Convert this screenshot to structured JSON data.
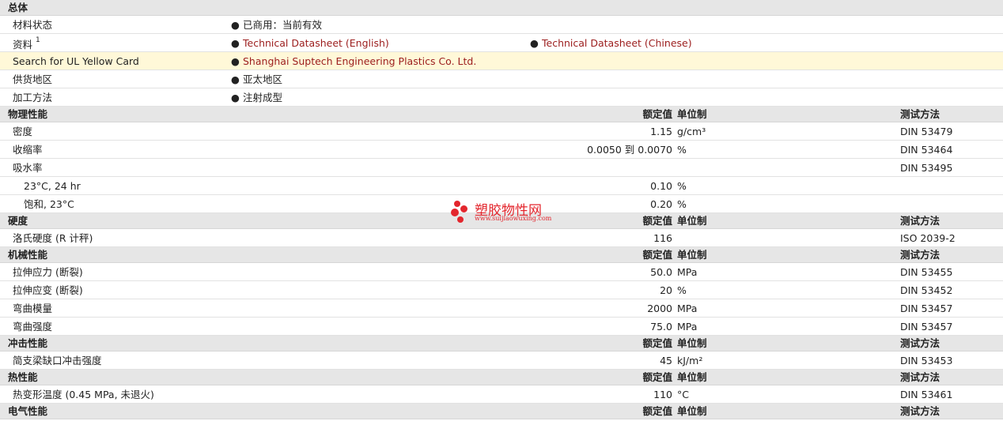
{
  "overview": {
    "title": "总体",
    "rows": [
      {
        "label": "材料状态",
        "items": [
          "已商用：当前有效"
        ]
      },
      {
        "label": "资料",
        "sup": "1",
        "items": [
          "Technical Datasheet (English)",
          "Technical Datasheet (Chinese)"
        ]
      },
      {
        "label": "Search for UL Yellow Card",
        "items": [
          "Shanghai Suptech Engineering Plastics Co. Ltd."
        ]
      },
      {
        "label": "供货地区",
        "items": [
          "亚太地区"
        ]
      },
      {
        "label": "加工方法",
        "items": [
          "注射成型"
        ]
      }
    ]
  },
  "columns": {
    "rated": "额定值",
    "unit": "单位制",
    "method": "测试方法"
  },
  "sections": [
    {
      "title": "物理性能",
      "rows": [
        {
          "label": "密度",
          "value": "1.15",
          "unit": "g/cm³",
          "method": "DIN 53479"
        },
        {
          "label": "收缩率",
          "value": "0.0050 到  0.0070",
          "unit": "%",
          "method": "DIN 53464"
        },
        {
          "label": "吸水率",
          "value": "",
          "unit": "",
          "method": "DIN 53495"
        },
        {
          "label": "23°C, 24 hr",
          "value": "0.10",
          "unit": "%",
          "method": "",
          "sub": true
        },
        {
          "label": "饱和, 23°C",
          "value": "0.20",
          "unit": "%",
          "method": "",
          "sub": true
        }
      ]
    },
    {
      "title": "硬度",
      "rows": [
        {
          "label": "洛氏硬度 (R 计秤)",
          "value": "116",
          "unit": "",
          "method": "ISO 2039-2"
        }
      ]
    },
    {
      "title": "机械性能",
      "rows": [
        {
          "label": "拉伸应力 (断裂)",
          "value": "50.0",
          "unit": "MPa",
          "method": "DIN 53455"
        },
        {
          "label": "拉伸应变 (断裂)",
          "value": "20",
          "unit": "%",
          "method": "DIN 53452"
        },
        {
          "label": "弯曲模量",
          "value": "2000",
          "unit": "MPa",
          "method": "DIN 53457"
        },
        {
          "label": "弯曲强度",
          "value": "75.0",
          "unit": "MPa",
          "method": "DIN 53457"
        }
      ]
    },
    {
      "title": "冲击性能",
      "rows": [
        {
          "label": "简支梁缺口冲击强度",
          "value": "45",
          "unit": "kJ/m²",
          "method": "DIN 53453"
        }
      ]
    },
    {
      "title": "热性能",
      "rows": [
        {
          "label": "热变形温度 (0.45 MPa, 未退火)",
          "value": "110",
          "unit": "°C",
          "method": "DIN 53461"
        }
      ]
    },
    {
      "title": "电气性能",
      "rows": []
    }
  ],
  "watermark": {
    "name": "塑胶物性网",
    "url": "www.suijiaowuxing.com"
  },
  "colors": {
    "header_bg": "#e6e6e6",
    "highlight_bg": "#fff8d8",
    "link": "#9b1c1c",
    "watermark": "#e3262d"
  }
}
